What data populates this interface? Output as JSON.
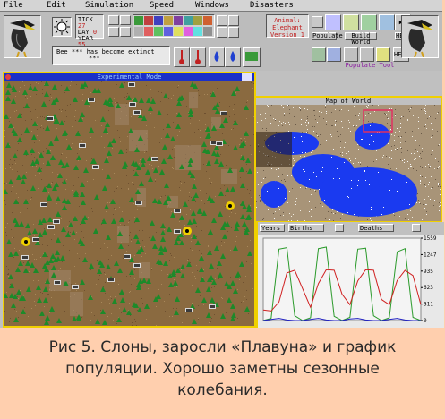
{
  "menu": [
    "File",
    "Edit",
    "Simulation",
    "Speed",
    "Windows",
    "Disasters"
  ],
  "status": {
    "tick_label": "TICK",
    "tick_value": "27",
    "day_label": "DAY",
    "day_value": "0",
    "year_label": "YEAR",
    "year_value": "55"
  },
  "message": {
    "line1": "Bee *** has become extinct",
    "line2": "***"
  },
  "animal_info": {
    "line1": "Animal:",
    "line2": "Elephant",
    "line3": "Version 1"
  },
  "buttons": {
    "populate": "Populate",
    "build_world": "Build World",
    "help": "HELP",
    "populate_tool": "Populate Tool"
  },
  "windows": {
    "experimental": "Experimental Mode",
    "map": "Map of World"
  },
  "graph": {
    "tab1": "Years",
    "tab2": "Births",
    "tab3": "Deaths",
    "y_ticks": [
      "1559",
      "1247",
      "935",
      "623",
      "311",
      "0"
    ]
  },
  "chart_data": {
    "type": "line",
    "y_ticks": [
      1559,
      1247,
      935,
      623,
      311,
      0
    ],
    "ylim": [
      0,
      1559
    ],
    "series": [
      {
        "color": "#2a9a2a",
        "values": [
          0,
          40,
          1350,
          1380,
          90,
          0,
          50,
          1360,
          1390,
          80,
          0,
          60,
          1350,
          1370,
          90,
          0,
          50,
          1300,
          1360,
          60,
          0
        ]
      },
      {
        "color": "#d02020",
        "values": [
          200,
          180,
          350,
          900,
          950,
          600,
          250,
          700,
          960,
          950,
          500,
          300,
          750,
          960,
          950,
          400,
          300,
          760,
          950,
          850,
          300
        ]
      },
      {
        "color": "#2020c0",
        "values": [
          0,
          20,
          40,
          10,
          0,
          0,
          20,
          40,
          10,
          0,
          0,
          30,
          40,
          10,
          0,
          0,
          20,
          40,
          10,
          0,
          0
        ]
      }
    ]
  },
  "caption": {
    "line1": "Рис 5. Слоны, заросли «Плавуна» и график",
    "line2": "популяции. Хорошо заметны сезонные",
    "line3": "колебания."
  },
  "colors": {
    "ground": "#8a6a40",
    "tree": "#1d8a2a",
    "water": "#1a3af0",
    "accent": "#f0d000"
  }
}
